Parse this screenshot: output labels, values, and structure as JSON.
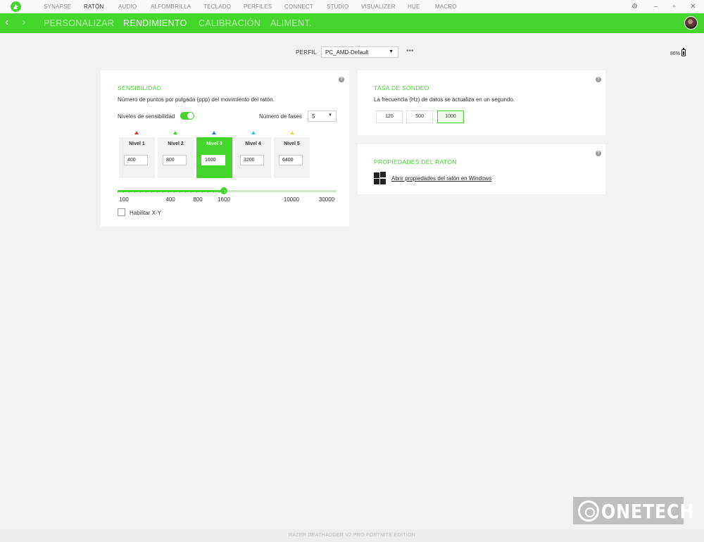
{
  "top_nav": {
    "items": [
      "SYNAPSE",
      "RATÓN",
      "AUDIO",
      "ALFOMBRILLA",
      "TECLADO",
      "PERFILES",
      "CONNECT",
      "STUDIO",
      "VISUALIZER",
      "HUE",
      "MACRO"
    ],
    "active": "RATÓN"
  },
  "sub_nav": {
    "tabs": [
      "PERSONALIZAR",
      "RENDIMIENTO",
      "CALIBRACIÓN",
      "ALIMENT."
    ],
    "active": "RENDIMIENTO"
  },
  "profile": {
    "label": "PERFIL",
    "value": "PC_AMD-Default",
    "more": "•••"
  },
  "battery": {
    "text": "86%",
    "level": 0.86
  },
  "sensitivity": {
    "title": "SENSIBILIDAD",
    "description": "Número de puntos por pulgada (ppp) del movimiento del ratón.",
    "toggle_label": "Niveles de sensibilidad",
    "toggle_on": true,
    "stages_label": "Número de fases",
    "stages_count": "5",
    "stages": [
      {
        "name": "Nivel 1",
        "value": "400",
        "color": "#e8372c"
      },
      {
        "name": "Nivel 2",
        "value": "800",
        "color": "#44d62c"
      },
      {
        "name": "Nivel 3",
        "value": "1600",
        "color": "#2c7be8",
        "active": true
      },
      {
        "name": "Nivel 4",
        "value": "3200",
        "color": "#2cc9e8"
      },
      {
        "name": "Nivel 5",
        "value": "6400",
        "color": "#e8e02c"
      }
    ],
    "slider_labels": [
      "100",
      "400",
      "800",
      "1600",
      "10000",
      "30000"
    ],
    "slider_value": 1600,
    "xy_label": "Habilitar X-Y",
    "xy_checked": false
  },
  "polling": {
    "title": "TASA DE SONDEO",
    "description": "La frecuencia (Hz) de datos se actualiza en un segundo.",
    "options": [
      "125",
      "500",
      "1000"
    ],
    "selected": "1000"
  },
  "properties": {
    "title": "PROPIEDADES DEL RATÓN",
    "link": "Abrir propiedades del ratón en Windows"
  },
  "footer": {
    "device": "RAZER DEATHADDER V2 PRO FORTNITE EDITION"
  },
  "watermark": {
    "text": "ONETECH"
  },
  "colors": {
    "accent": "#44d62c"
  },
  "icons": {
    "logo": "razer-logo-icon",
    "settings": "gear-icon",
    "minimize": "minimize-icon",
    "maximize": "maximize-icon",
    "close": "close-icon",
    "back": "chevron-left-icon",
    "forward": "chevron-right-icon",
    "help": "help-icon",
    "battery": "battery-icon",
    "windows": "windows-icon"
  }
}
